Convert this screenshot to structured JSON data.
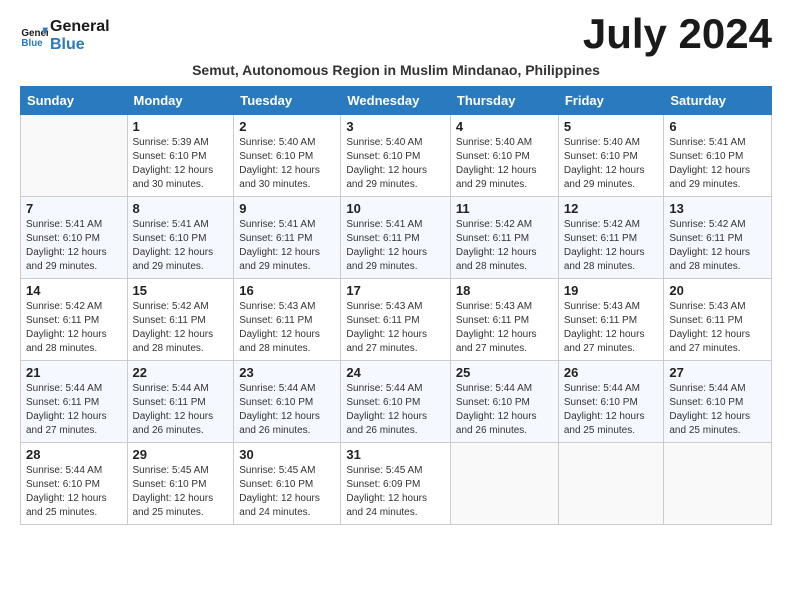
{
  "logo": {
    "line1": "General",
    "line2": "Blue"
  },
  "title": "July 2024",
  "subtitle": "Semut, Autonomous Region in Muslim Mindanao, Philippines",
  "headers": [
    "Sunday",
    "Monday",
    "Tuesday",
    "Wednesday",
    "Thursday",
    "Friday",
    "Saturday"
  ],
  "weeks": [
    [
      {
        "day": "",
        "sunrise": "",
        "sunset": "",
        "daylight": ""
      },
      {
        "day": "1",
        "sunrise": "Sunrise: 5:39 AM",
        "sunset": "Sunset: 6:10 PM",
        "daylight": "Daylight: 12 hours and 30 minutes."
      },
      {
        "day": "2",
        "sunrise": "Sunrise: 5:40 AM",
        "sunset": "Sunset: 6:10 PM",
        "daylight": "Daylight: 12 hours and 30 minutes."
      },
      {
        "day": "3",
        "sunrise": "Sunrise: 5:40 AM",
        "sunset": "Sunset: 6:10 PM",
        "daylight": "Daylight: 12 hours and 29 minutes."
      },
      {
        "day": "4",
        "sunrise": "Sunrise: 5:40 AM",
        "sunset": "Sunset: 6:10 PM",
        "daylight": "Daylight: 12 hours and 29 minutes."
      },
      {
        "day": "5",
        "sunrise": "Sunrise: 5:40 AM",
        "sunset": "Sunset: 6:10 PM",
        "daylight": "Daylight: 12 hours and 29 minutes."
      },
      {
        "day": "6",
        "sunrise": "Sunrise: 5:41 AM",
        "sunset": "Sunset: 6:10 PM",
        "daylight": "Daylight: 12 hours and 29 minutes."
      }
    ],
    [
      {
        "day": "7",
        "sunrise": "Sunrise: 5:41 AM",
        "sunset": "Sunset: 6:10 PM",
        "daylight": "Daylight: 12 hours and 29 minutes."
      },
      {
        "day": "8",
        "sunrise": "Sunrise: 5:41 AM",
        "sunset": "Sunset: 6:10 PM",
        "daylight": "Daylight: 12 hours and 29 minutes."
      },
      {
        "day": "9",
        "sunrise": "Sunrise: 5:41 AM",
        "sunset": "Sunset: 6:11 PM",
        "daylight": "Daylight: 12 hours and 29 minutes."
      },
      {
        "day": "10",
        "sunrise": "Sunrise: 5:41 AM",
        "sunset": "Sunset: 6:11 PM",
        "daylight": "Daylight: 12 hours and 29 minutes."
      },
      {
        "day": "11",
        "sunrise": "Sunrise: 5:42 AM",
        "sunset": "Sunset: 6:11 PM",
        "daylight": "Daylight: 12 hours and 28 minutes."
      },
      {
        "day": "12",
        "sunrise": "Sunrise: 5:42 AM",
        "sunset": "Sunset: 6:11 PM",
        "daylight": "Daylight: 12 hours and 28 minutes."
      },
      {
        "day": "13",
        "sunrise": "Sunrise: 5:42 AM",
        "sunset": "Sunset: 6:11 PM",
        "daylight": "Daylight: 12 hours and 28 minutes."
      }
    ],
    [
      {
        "day": "14",
        "sunrise": "Sunrise: 5:42 AM",
        "sunset": "Sunset: 6:11 PM",
        "daylight": "Daylight: 12 hours and 28 minutes."
      },
      {
        "day": "15",
        "sunrise": "Sunrise: 5:42 AM",
        "sunset": "Sunset: 6:11 PM",
        "daylight": "Daylight: 12 hours and 28 minutes."
      },
      {
        "day": "16",
        "sunrise": "Sunrise: 5:43 AM",
        "sunset": "Sunset: 6:11 PM",
        "daylight": "Daylight: 12 hours and 28 minutes."
      },
      {
        "day": "17",
        "sunrise": "Sunrise: 5:43 AM",
        "sunset": "Sunset: 6:11 PM",
        "daylight": "Daylight: 12 hours and 27 minutes."
      },
      {
        "day": "18",
        "sunrise": "Sunrise: 5:43 AM",
        "sunset": "Sunset: 6:11 PM",
        "daylight": "Daylight: 12 hours and 27 minutes."
      },
      {
        "day": "19",
        "sunrise": "Sunrise: 5:43 AM",
        "sunset": "Sunset: 6:11 PM",
        "daylight": "Daylight: 12 hours and 27 minutes."
      },
      {
        "day": "20",
        "sunrise": "Sunrise: 5:43 AM",
        "sunset": "Sunset: 6:11 PM",
        "daylight": "Daylight: 12 hours and 27 minutes."
      }
    ],
    [
      {
        "day": "21",
        "sunrise": "Sunrise: 5:44 AM",
        "sunset": "Sunset: 6:11 PM",
        "daylight": "Daylight: 12 hours and 27 minutes."
      },
      {
        "day": "22",
        "sunrise": "Sunrise: 5:44 AM",
        "sunset": "Sunset: 6:11 PM",
        "daylight": "Daylight: 12 hours and 26 minutes."
      },
      {
        "day": "23",
        "sunrise": "Sunrise: 5:44 AM",
        "sunset": "Sunset: 6:10 PM",
        "daylight": "Daylight: 12 hours and 26 minutes."
      },
      {
        "day": "24",
        "sunrise": "Sunrise: 5:44 AM",
        "sunset": "Sunset: 6:10 PM",
        "daylight": "Daylight: 12 hours and 26 minutes."
      },
      {
        "day": "25",
        "sunrise": "Sunrise: 5:44 AM",
        "sunset": "Sunset: 6:10 PM",
        "daylight": "Daylight: 12 hours and 26 minutes."
      },
      {
        "day": "26",
        "sunrise": "Sunrise: 5:44 AM",
        "sunset": "Sunset: 6:10 PM",
        "daylight": "Daylight: 12 hours and 25 minutes."
      },
      {
        "day": "27",
        "sunrise": "Sunrise: 5:44 AM",
        "sunset": "Sunset: 6:10 PM",
        "daylight": "Daylight: 12 hours and 25 minutes."
      }
    ],
    [
      {
        "day": "28",
        "sunrise": "Sunrise: 5:44 AM",
        "sunset": "Sunset: 6:10 PM",
        "daylight": "Daylight: 12 hours and 25 minutes."
      },
      {
        "day": "29",
        "sunrise": "Sunrise: 5:45 AM",
        "sunset": "Sunset: 6:10 PM",
        "daylight": "Daylight: 12 hours and 25 minutes."
      },
      {
        "day": "30",
        "sunrise": "Sunrise: 5:45 AM",
        "sunset": "Sunset: 6:10 PM",
        "daylight": "Daylight: 12 hours and 24 minutes."
      },
      {
        "day": "31",
        "sunrise": "Sunrise: 5:45 AM",
        "sunset": "Sunset: 6:09 PM",
        "daylight": "Daylight: 12 hours and 24 minutes."
      },
      {
        "day": "",
        "sunrise": "",
        "sunset": "",
        "daylight": ""
      },
      {
        "day": "",
        "sunrise": "",
        "sunset": "",
        "daylight": ""
      },
      {
        "day": "",
        "sunrise": "",
        "sunset": "",
        "daylight": ""
      }
    ]
  ]
}
